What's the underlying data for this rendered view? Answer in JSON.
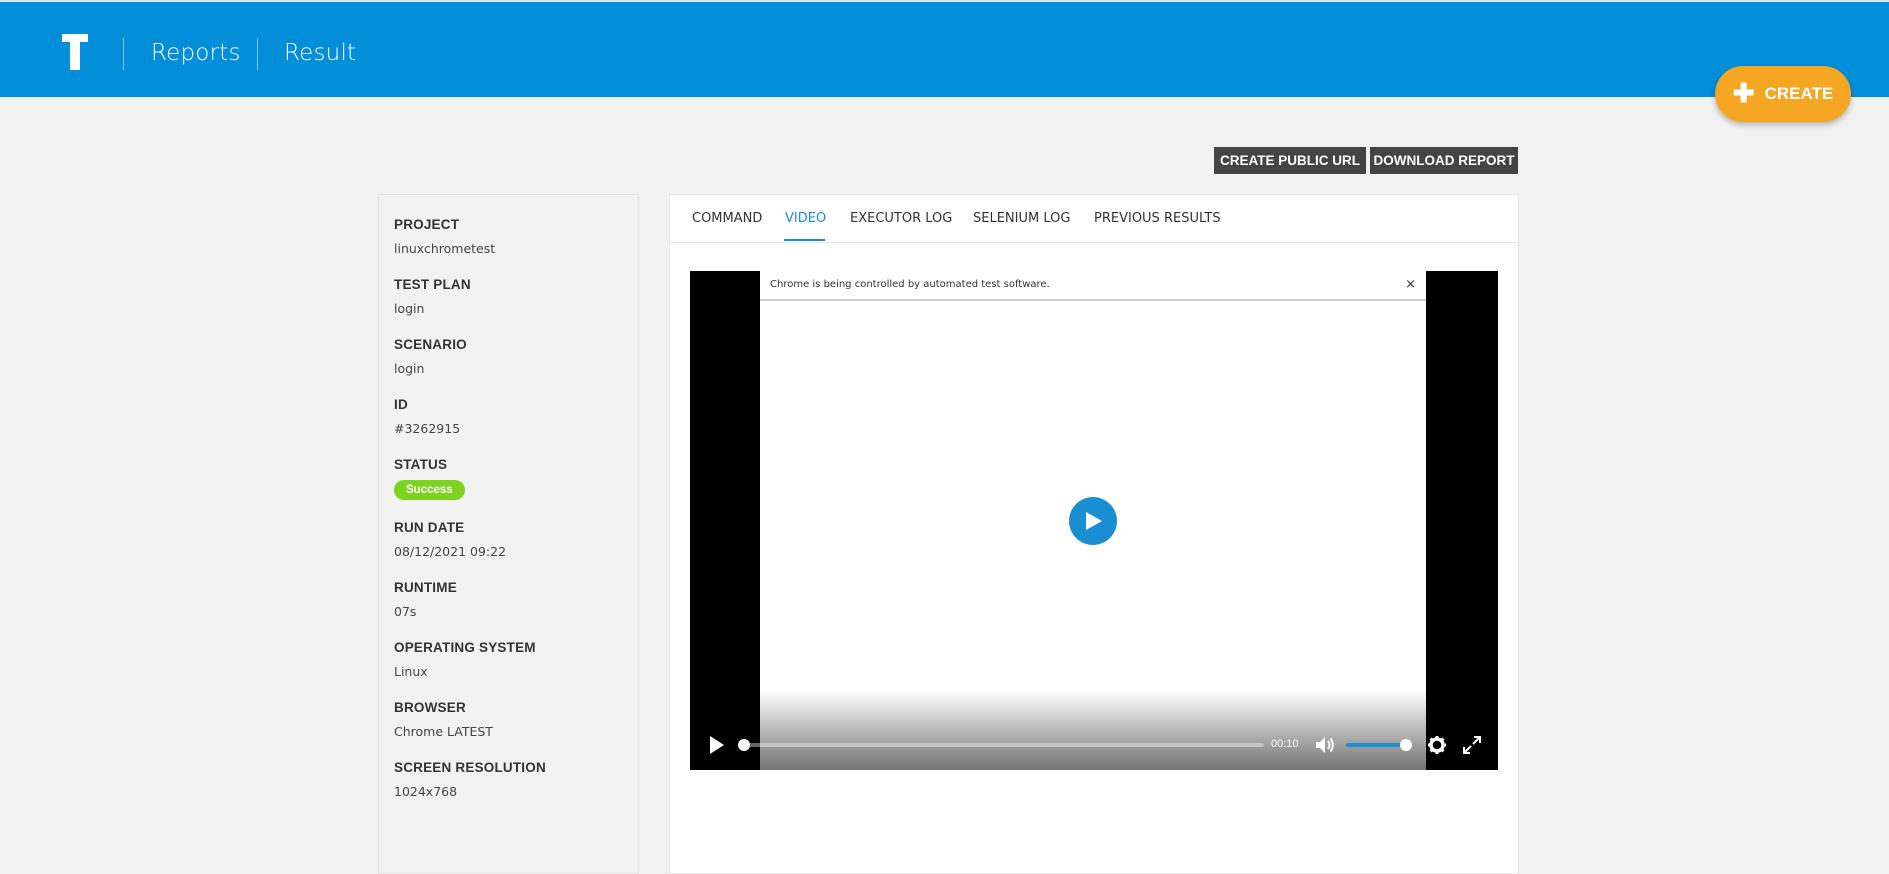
{
  "header": {
    "logo_letter": "T",
    "breadcrumbs": [
      "Reports",
      "Result"
    ],
    "create_label": "CREATE",
    "brand_color": "#028ed8",
    "accent_color": "#f5a623"
  },
  "actions": {
    "public_url_label": "CREATE PUBLIC URL",
    "download_label": "DOWNLOAD REPORT"
  },
  "details": {
    "project": {
      "label": "PROJECT",
      "value": "linuxchrometest"
    },
    "test_plan": {
      "label": "TEST PLAN",
      "value": "login"
    },
    "scenario": {
      "label": "SCENARIO",
      "value": "login"
    },
    "id": {
      "label": "ID",
      "value": "#3262915"
    },
    "status": {
      "label": "STATUS",
      "value": "Success",
      "color": "#7ed321"
    },
    "run_date": {
      "label": "RUN DATE",
      "value": "08/12/2021 09:22"
    },
    "runtime": {
      "label": "RUNTIME",
      "value": "07s"
    },
    "os": {
      "label": "OPERATING SYSTEM",
      "value": "Linux"
    },
    "browser": {
      "label": "BROWSER",
      "value": "Chrome LATEST"
    },
    "resolution": {
      "label": "SCREEN RESOLUTION",
      "value": "1024x768"
    }
  },
  "tabs": [
    {
      "label": "COMMAND",
      "active": false
    },
    {
      "label": "VIDEO",
      "active": true
    },
    {
      "label": "EXECUTOR LOG",
      "active": false
    },
    {
      "label": "SELENIUM LOG",
      "active": false
    },
    {
      "label": "PREVIOUS RESULTS",
      "active": false
    }
  ],
  "video": {
    "infobar_text": "Chrome is being controlled by automated test software.",
    "infobar_close": "×",
    "timecode": "00:10",
    "progress_fraction": 0.0,
    "volume_fraction": 1.0,
    "icons": [
      "play-icon",
      "volume-icon",
      "settings-icon",
      "fullscreen-icon"
    ]
  }
}
